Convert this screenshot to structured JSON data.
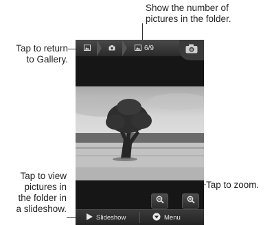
{
  "callouts": {
    "folder_count": [
      "Show the number of",
      "pictures in the folder."
    ],
    "return_gallery": [
      "Tap to return",
      "to Gallery."
    ],
    "slideshow": [
      "Tap to view",
      "pictures in",
      "the folder in",
      "a slideshow."
    ],
    "zoom": "Tap to zoom."
  },
  "topbar": {
    "breadcrumbs": [
      "gallery-icon",
      "camera-icon",
      "picture-icon"
    ],
    "count": "6/9",
    "camera_button_icon": "camera-icon"
  },
  "photo": {
    "subject": "tree-photo"
  },
  "zoom": {
    "out_icon": "zoom-out-icon",
    "in_icon": "zoom-in-icon"
  },
  "bottombar": {
    "slideshow_label": "Slideshow",
    "slideshow_icon": "play-icon",
    "menu_label": "Menu",
    "menu_icon": "menu-icon"
  },
  "colors": {
    "screen_bg": "#161616",
    "bar": "#2a2a2a",
    "text": "#e8e8e8"
  }
}
